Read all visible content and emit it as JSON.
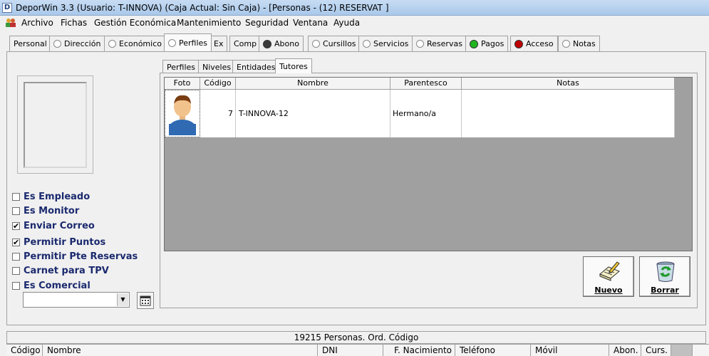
{
  "window": {
    "title": "DeporWin 3.3  (Usuario: T-INNOVA)  (Caja Actual: Sin Caja) - [Personas - (12) RESERVAT  ]"
  },
  "menu": {
    "items": [
      {
        "label": "Archivo"
      },
      {
        "label": "Fichas"
      },
      {
        "label": "Gestión Económica"
      },
      {
        "label": "Mantenimiento"
      },
      {
        "label": "Seguridad"
      },
      {
        "label": "Ventana"
      },
      {
        "label": "Ayuda"
      }
    ]
  },
  "tabs": [
    {
      "label": "Personal",
      "indicator": "none"
    },
    {
      "label": "Dirección",
      "indicator": "radio"
    },
    {
      "label": "Económico",
      "indicator": "radio"
    },
    {
      "label": "Perfiles",
      "indicator": "radio",
      "active": true
    },
    {
      "label": "Ex",
      "indicator": "none"
    },
    {
      "label": "Comp",
      "indicator": "none"
    },
    {
      "label": "Abono",
      "indicator": "dark",
      "color": "#3a3a3a"
    },
    {
      "label": "Cursillos",
      "indicator": "radio"
    },
    {
      "label": "Servicios",
      "indicator": "radio"
    },
    {
      "label": "Reservas",
      "indicator": "radio"
    },
    {
      "label": "Pagos",
      "indicator": "green",
      "color": "#1fb51f"
    },
    {
      "label": "Acceso",
      "indicator": "red",
      "color": "#c00000"
    },
    {
      "label": "Notas",
      "indicator": "radio"
    }
  ],
  "checkboxes": [
    {
      "label": "Es Empleado",
      "checked": false
    },
    {
      "label": "Es Monitor",
      "checked": false
    },
    {
      "label": "Enviar Correo",
      "checked": true
    },
    {
      "label": "Permitir Puntos",
      "checked": true
    },
    {
      "label": "Permitir Pte Reservas",
      "checked": false
    },
    {
      "label": "Carnet para TPV",
      "checked": false
    },
    {
      "label": "Es Comercial",
      "checked": false
    }
  ],
  "subtabs": [
    {
      "label": "Perfiles"
    },
    {
      "label": "Niveles"
    },
    {
      "label": "Entidades"
    },
    {
      "label": "Tutores",
      "active": true
    }
  ],
  "grid": {
    "columns": [
      "Foto",
      "Código",
      "Nombre",
      "Parentesco",
      "Notas"
    ],
    "rows": [
      {
        "foto": "user-avatar-icon",
        "codigo": "7",
        "nombre": "T-INNOVA-12",
        "parentesco": "Hermano/a",
        "notas": ""
      }
    ]
  },
  "buttons": {
    "nuevo": "Nuevo",
    "borrar": "Borrar"
  },
  "status": {
    "text": "19215 Personas. Ord. Código"
  },
  "bottom_columns": [
    "Código",
    "Nombre",
    "DNI",
    "F. Nacimiento",
    "Teléfono",
    "Móvil",
    "Abon.",
    "Curs."
  ]
}
